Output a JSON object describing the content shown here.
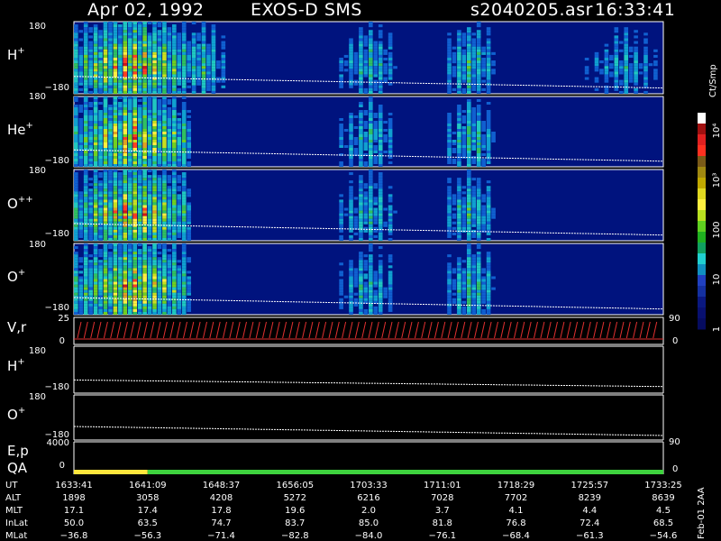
{
  "header": {
    "date": "Apr 02, 1992",
    "instrument": "EXOS-D SMS",
    "file": "s2040205.asr",
    "time": "16:33:41"
  },
  "colors": {
    "background_dark": "#000000",
    "spectrogram_bg": "#00137e",
    "text": "#ffffff",
    "qa_yellow": "#ffe63c",
    "qa_green": "#3ed23e",
    "velocity_red": "#e03030"
  },
  "panels": [
    {
      "label": "H",
      "sup": "+",
      "ymax": "180",
      "ymin": "−180"
    },
    {
      "label": "He",
      "sup": "+",
      "ymax": "180",
      "ymin": "−180"
    },
    {
      "label": "O",
      "sup": "++",
      "ymax": "180",
      "ymin": "−180"
    },
    {
      "label": "O",
      "sup": "+",
      "ymax": "180",
      "ymin": "−180"
    }
  ],
  "vr_panel": {
    "label": "V,r",
    "ymax": "25",
    "ymin": "0",
    "right_top": "90",
    "right_bottom": "0"
  },
  "angle_panels": [
    {
      "label": "H",
      "sup": "+",
      "ymax": "180",
      "ymin": "−180"
    },
    {
      "label": "O",
      "sup": "+",
      "ymax": "180",
      "ymin": "−180"
    }
  ],
  "ep_panel": {
    "label": "E,p",
    "ymax": "4000",
    "right": "90"
  },
  "qa_panel": {
    "label": "QA",
    "ymin": "0",
    "right": "0"
  },
  "colorbar": {
    "unit": "Ct/Smp",
    "tick_labels": [
      "10⁴",
      "10³",
      "100",
      "10",
      "1"
    ],
    "colors": [
      "#ffffff",
      "#a01010",
      "#e02020",
      "#ff3020",
      "#7a5a18",
      "#a08810",
      "#c0a800",
      "#e0d820",
      "#fff040",
      "#b8e020",
      "#60d020",
      "#20b020",
      "#10a060",
      "#20d0d0",
      "#1090c0",
      "#2040c0",
      "#1430a0",
      "#0a1880",
      "#081070",
      "#060c60"
    ]
  },
  "table": {
    "rows": [
      {
        "label": "UT",
        "values": [
          "1633:41",
          "1641:09",
          "1648:37",
          "1656:05",
          "1703:33",
          "1711:01",
          "1718:29",
          "1725:57",
          "1733:25"
        ]
      },
      {
        "label": "ALT",
        "values": [
          "1898",
          "3058",
          "4208",
          "5272",
          "6216",
          "7028",
          "7702",
          "8239",
          "8639"
        ]
      },
      {
        "label": "MLT",
        "values": [
          "17.1",
          "17.4",
          "17.8",
          "19.6",
          "2.0",
          "3.7",
          "4.1",
          "4.4",
          "4.5"
        ]
      },
      {
        "label": "InLat",
        "values": [
          "50.0",
          "63.5",
          "74.7",
          "83.7",
          "85.0",
          "81.8",
          "76.8",
          "72.4",
          "68.5"
        ]
      },
      {
        "label": "MLat",
        "values": [
          "−36.8",
          "−56.3",
          "−71.4",
          "−82.8",
          "−84.0",
          "−76.1",
          "−68.4",
          "−61.3",
          "−54.6"
        ]
      }
    ],
    "footer": "Feb-01 2AA"
  },
  "chart_data": {
    "type": "heatmap",
    "title": "Apr 02, 1992   EXOS-D SMS   s2040205.asr   16:33:41",
    "x_axis": {
      "ticks": [
        "1633:41",
        "1641:09",
        "1648:37",
        "1656:05",
        "1703:33",
        "1711:01",
        "1718:29",
        "1725:57",
        "1733:25"
      ]
    },
    "y_range": [
      -180,
      180
    ],
    "series": [
      {
        "name": "H+",
        "activity": [
          [
            0.0,
            0.2,
            0.95
          ],
          [
            0.18,
            0.26,
            0.5
          ],
          [
            0.45,
            0.55,
            0.45
          ],
          [
            0.63,
            0.72,
            0.5
          ],
          [
            0.87,
            1.0,
            0.35
          ]
        ]
      },
      {
        "name": "He+",
        "activity": [
          [
            0.0,
            0.2,
            0.95
          ],
          [
            0.45,
            0.55,
            0.45
          ],
          [
            0.63,
            0.72,
            0.5
          ]
        ]
      },
      {
        "name": "O++",
        "activity": [
          [
            0.0,
            0.2,
            0.95
          ],
          [
            0.45,
            0.55,
            0.45
          ],
          [
            0.63,
            0.72,
            0.5
          ]
        ]
      },
      {
        "name": "O+",
        "activity": [
          [
            0.0,
            0.2,
            0.95
          ],
          [
            0.45,
            0.55,
            0.45
          ],
          [
            0.63,
            0.72,
            0.5
          ]
        ]
      }
    ],
    "colorbar_range": [
      1,
      10000
    ],
    "colorbar_scale": "log",
    "qa": [
      {
        "from": "1633:41",
        "to": "1641:09",
        "color": "#ffe63c"
      },
      {
        "from": "1641:09",
        "to": "1733:25",
        "color": "#3ed23e"
      }
    ]
  }
}
